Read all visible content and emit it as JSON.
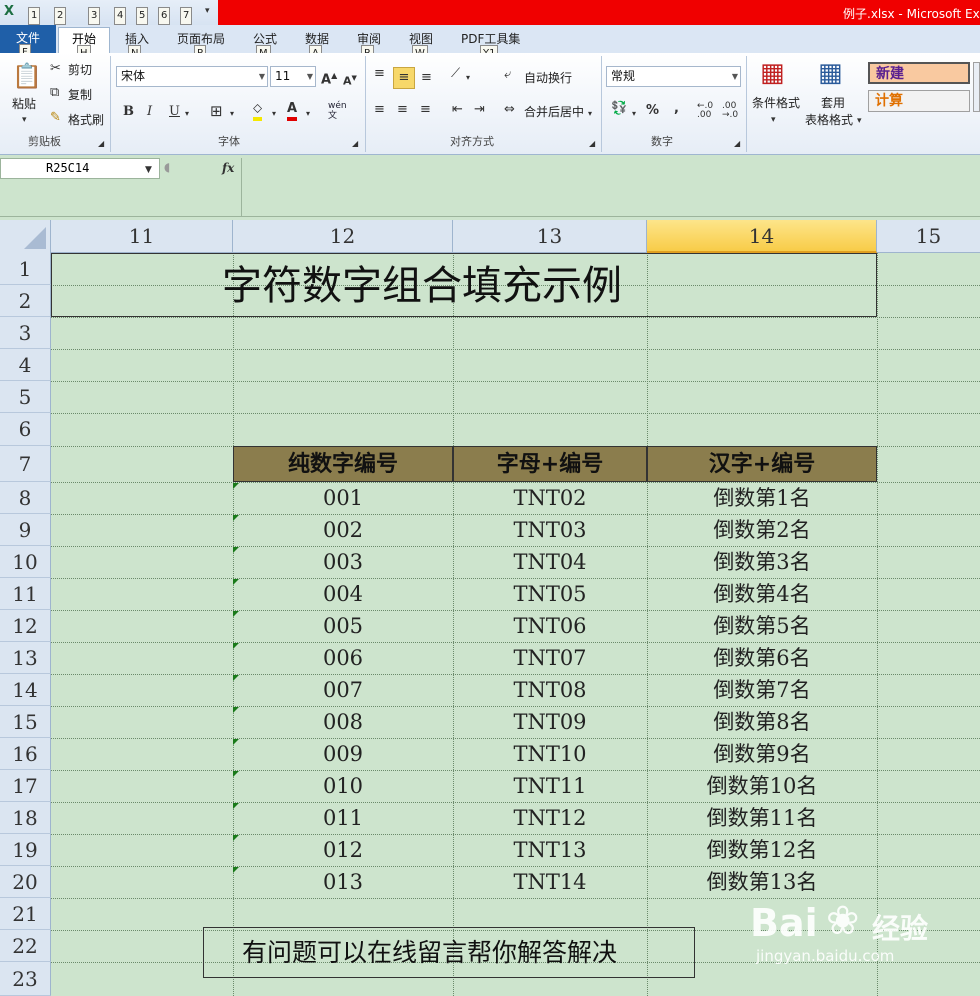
{
  "window": {
    "title": "例子.xlsx - Microsoft Ex"
  },
  "qat": {
    "keytips": [
      "1",
      "2",
      "3",
      "4",
      "5",
      "6",
      "7"
    ]
  },
  "tabs": [
    {
      "label": "文件",
      "keytip": "F"
    },
    {
      "label": "开始",
      "keytip": "H"
    },
    {
      "label": "插入",
      "keytip": "N"
    },
    {
      "label": "页面布局",
      "keytip": "P"
    },
    {
      "label": "公式",
      "keytip": "M"
    },
    {
      "label": "数据",
      "keytip": "A"
    },
    {
      "label": "审阅",
      "keytip": "R"
    },
    {
      "label": "视图",
      "keytip": "W"
    },
    {
      "label": "PDF工具集",
      "keytip": "Y1"
    }
  ],
  "ribbon": {
    "clipboard": {
      "group": "剪贴板",
      "paste": "粘贴",
      "cut": "剪切",
      "copy": "复制",
      "format_painter": "格式刷"
    },
    "font": {
      "group": "字体",
      "font_name": "宋体",
      "font_size": "11",
      "bold": "B",
      "italic": "I",
      "underline": "U",
      "font_color_letter": "A",
      "phonetic": "wén 文"
    },
    "alignment": {
      "group": "对齐方式",
      "wrap": "自动换行",
      "merge": "合并后居中"
    },
    "number": {
      "group": "数字",
      "format": "常规",
      "percent": "%",
      "comma": ","
    },
    "styles": {
      "conditional": "条件格式",
      "table_format_1": "套用",
      "table_format_2": "表格格式",
      "style_new": "新建",
      "style_calc": "计算"
    }
  },
  "formula_bar": {
    "name_box": "R25C14",
    "fx": "fx"
  },
  "columns": [
    "11",
    "12",
    "13",
    "14",
    "15"
  ],
  "rows": [
    "1",
    "2",
    "3",
    "4",
    "5",
    "6",
    "7",
    "8",
    "9",
    "10",
    "11",
    "12",
    "13",
    "14",
    "15",
    "16",
    "17",
    "18",
    "19",
    "20",
    "21",
    "22",
    "23"
  ],
  "sheet": {
    "title": "字符数字组合填充示例",
    "headers": [
      "纯数字编号",
      "字母+编号",
      "汉字+编号"
    ],
    "data": [
      [
        "001",
        "TNT02",
        "倒数第1名"
      ],
      [
        "002",
        "TNT03",
        "倒数第2名"
      ],
      [
        "003",
        "TNT04",
        "倒数第3名"
      ],
      [
        "004",
        "TNT05",
        "倒数第4名"
      ],
      [
        "005",
        "TNT06",
        "倒数第5名"
      ],
      [
        "006",
        "TNT07",
        "倒数第6名"
      ],
      [
        "007",
        "TNT08",
        "倒数第7名"
      ],
      [
        "008",
        "TNT09",
        "倒数第8名"
      ],
      [
        "009",
        "TNT10",
        "倒数第9名"
      ],
      [
        "010",
        "TNT11",
        "倒数第10名"
      ],
      [
        "011",
        "TNT12",
        "倒数第11名"
      ],
      [
        "012",
        "TNT13",
        "倒数第12名"
      ],
      [
        "013",
        "TNT14",
        "倒数第13名"
      ]
    ],
    "note": "有问题可以在线留言帮你解答解决"
  },
  "watermark": {
    "brand": "Bai",
    "brand2": "经验",
    "url": "jingyan.baidu.com"
  },
  "colors": {
    "sheet_bg": "#cde4cd",
    "header_fill": "#8b7d4d",
    "title_bar": "#f00000",
    "selected_col": "#f8cc48"
  }
}
